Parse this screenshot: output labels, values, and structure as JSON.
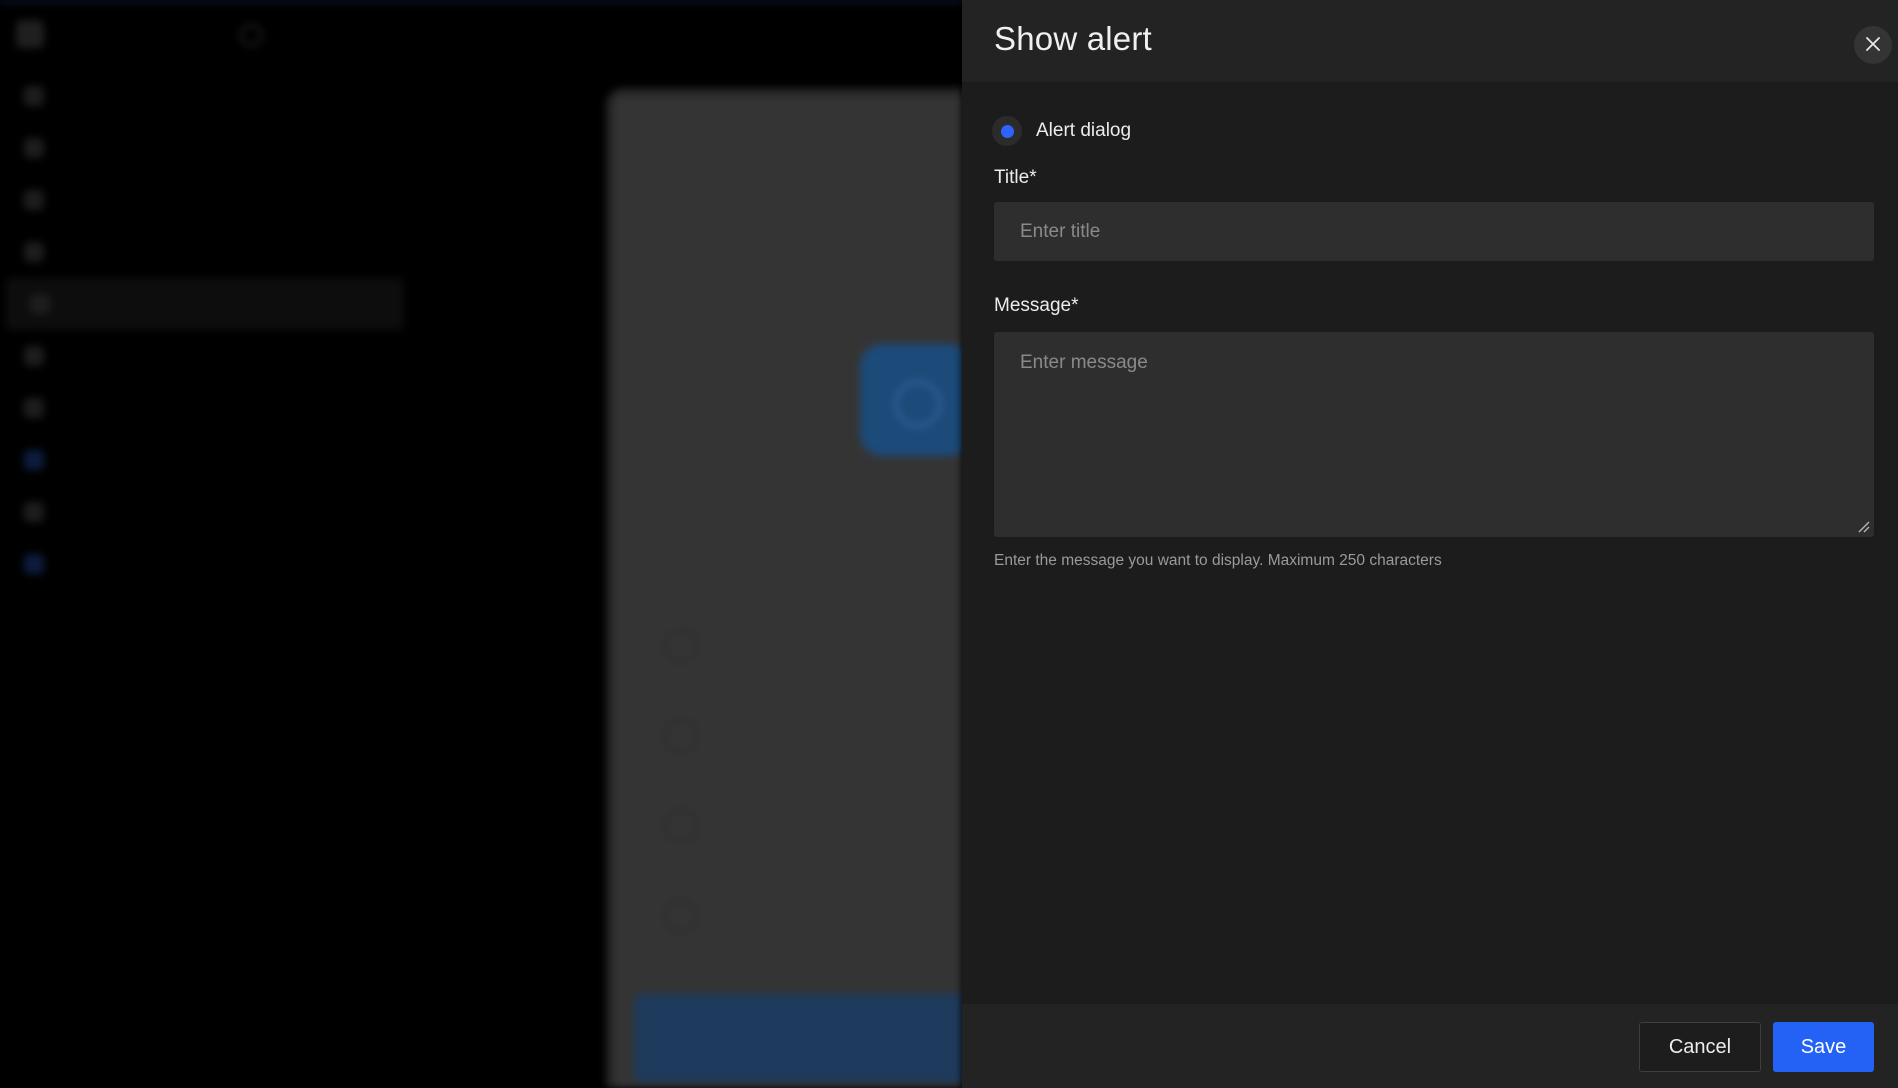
{
  "panel": {
    "title": "Show alert",
    "close_icon": "close-icon",
    "radio_option": "Alert dialog",
    "title_field": {
      "label": "Title*",
      "placeholder": "Enter title"
    },
    "message_field": {
      "label": "Message*",
      "placeholder": "Enter message",
      "help": "Enter the message you want to display. Maximum 250 characters"
    },
    "cancel_label": "Cancel",
    "save_label": "Save"
  },
  "colors": {
    "accent": "#2362f5",
    "panel_bg": "#1c1c1c",
    "input_bg": "#2e2e2e"
  }
}
